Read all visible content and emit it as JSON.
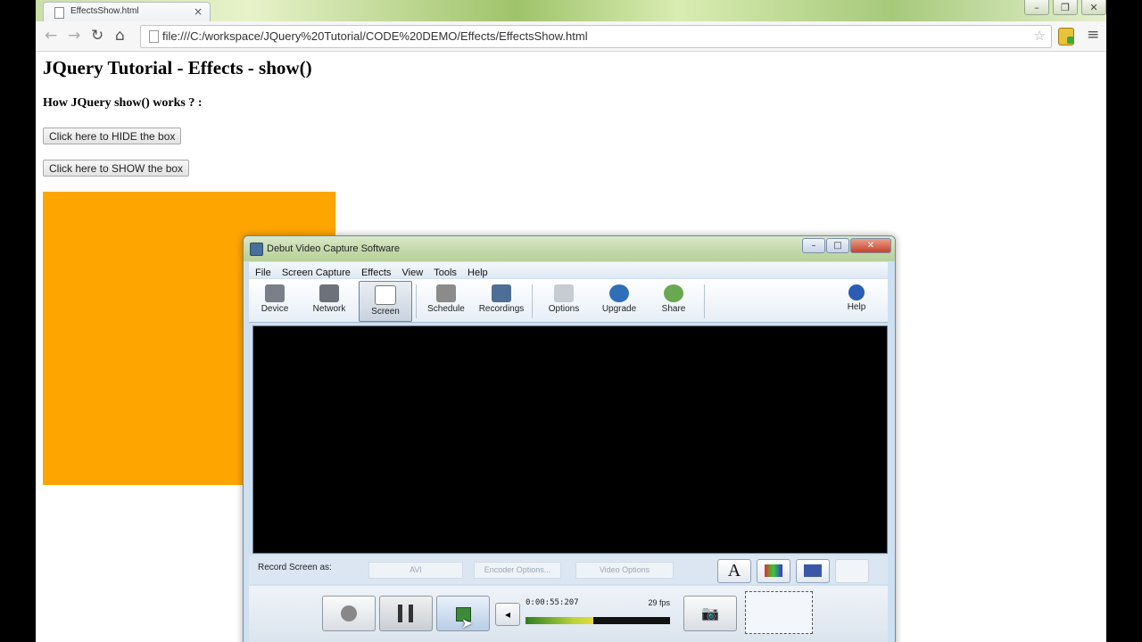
{
  "browser": {
    "tab_title": "EffectsShow.html",
    "tab_close": "×",
    "url": "file:///C:/workspace/JQuery%20Tutorial/CODE%20DEMO/Effects/EffectsShow.html",
    "icons": {
      "back": "←",
      "forward": "→",
      "reload": "↻",
      "home": "⌂",
      "star": "☆",
      "menu": "≡"
    },
    "window_buttons": {
      "minimize": "–",
      "restore": "❐",
      "close": "✕"
    }
  },
  "page": {
    "heading": "JQuery Tutorial - Effects - show()",
    "subheading": "How JQuery show() works ? :",
    "hide_button": "Click here to HIDE the box",
    "show_button": "Click here to SHOW the box",
    "box_color": "#ffa500"
  },
  "debut": {
    "title": "Debut Video Capture Software",
    "window_buttons": {
      "minimize": "–",
      "maximize": "□",
      "close": "✕"
    },
    "menu": [
      "File",
      "Screen Capture",
      "Effects",
      "View",
      "Tools",
      "Help"
    ],
    "toolbar": [
      {
        "label": "Device",
        "icon": "webcam-icon"
      },
      {
        "label": "Network",
        "icon": "network-camera-icon"
      },
      {
        "label": "Screen",
        "icon": "screen-icon",
        "active": true
      },
      {
        "label": "Schedule",
        "icon": "schedule-icon"
      },
      {
        "label": "Recordings",
        "icon": "recordings-icon"
      },
      {
        "label": "Options",
        "icon": "options-icon"
      },
      {
        "label": "Upgrade",
        "icon": "upgrade-icon"
      },
      {
        "label": "Share",
        "icon": "share-icon"
      },
      {
        "label": "Help",
        "icon": "help-icon"
      }
    ],
    "record_label": "Record Screen as:",
    "format_value": "AVI",
    "encoder_options": "Encoder Options...",
    "video_options": "Video Options",
    "text_effect": "A",
    "timer": "0:00:55:207",
    "fps": "29 fps",
    "volume_icon": "◂",
    "snapshot_icon": "📷"
  }
}
